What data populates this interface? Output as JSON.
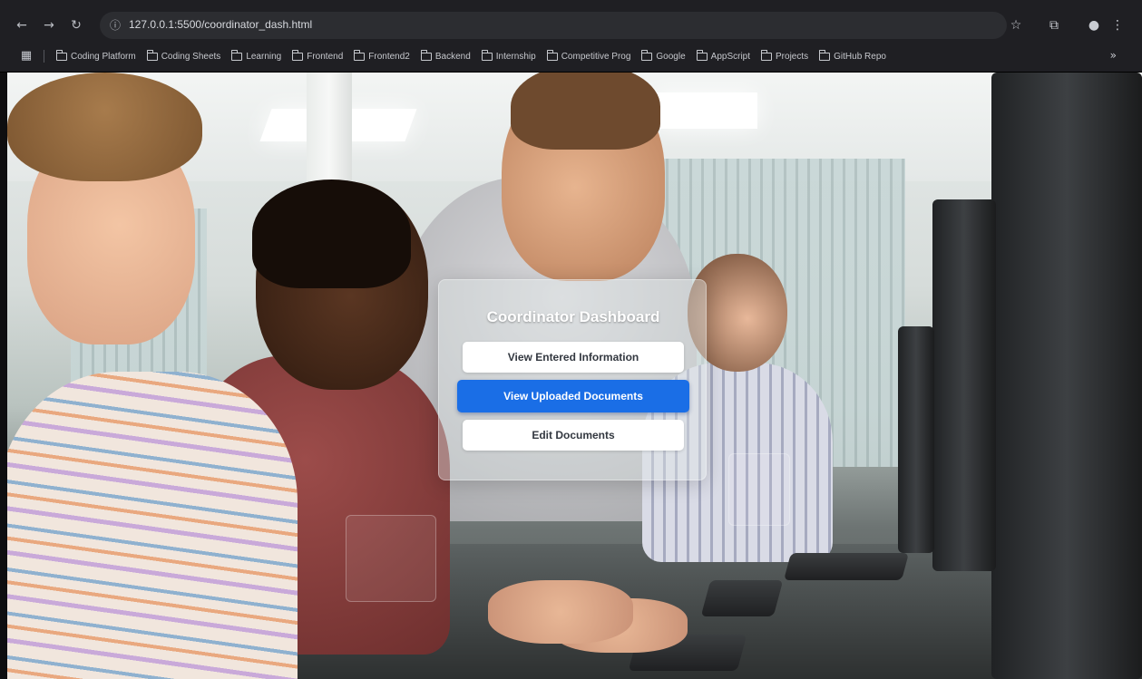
{
  "browser": {
    "url": "127.0.0.1:5500/coordinator_dash.html",
    "bookmarks": [
      "Coding Platform",
      "Coding Sheets",
      "Learning",
      "Frontend",
      "Frontend2",
      "Backend",
      "Internship",
      "Competitive Prog",
      "Google",
      "AppScript",
      "Projects",
      "GitHub Repo"
    ]
  },
  "dashboard": {
    "title": "Coordinator Dashboard",
    "buttons": {
      "view_entered": "View Entered Information",
      "view_uploaded": "View Uploaded Documents",
      "edit_documents": "Edit Documents"
    },
    "active_button_color": "#1a6ee6"
  }
}
